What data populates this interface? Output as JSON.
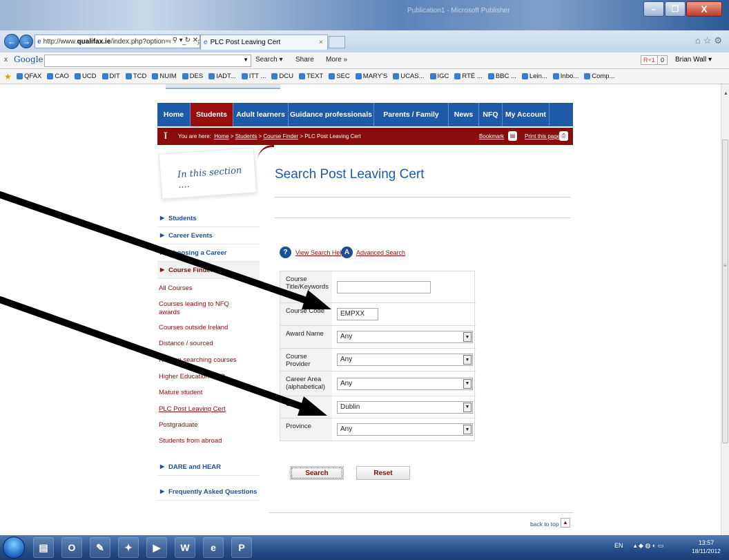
{
  "window": {
    "title": "Publication1 - Microsoft Publisher",
    "min_symbol": "–",
    "max_symbol": "❐",
    "close_symbol": "X"
  },
  "browser": {
    "address_prefix": "http://www.",
    "address_domain": "qualifax.ie",
    "address_rest": "/index.php?option=com_wrapper&view=w",
    "address_controls": "⚲ ▾ ↻ ✕",
    "tab_title": "PLC Post Leaving Cert",
    "tab_close": "×",
    "right_icons": "⌂☆⚙"
  },
  "google_toolbar": {
    "close": "x",
    "logo": "Google",
    "search_label": "Search ▾",
    "share_label": "Share",
    "more_label": "More »",
    "plusone": "R+1",
    "plusone_count": "0",
    "user": "Brian Wall ▾"
  },
  "favorites": [
    "QFAX",
    "CAO",
    "UCD",
    "DIT",
    "TCD",
    "NUIM",
    "DES",
    "IADT...",
    "ITT ...",
    "DCU",
    "TEXT",
    "SEC",
    "MARY'S",
    "UCAS...",
    "IGC",
    "RTÉ ...",
    "BBC ...",
    "Lein...",
    "Inbo...",
    "Comp..."
  ],
  "mainnav": [
    "Home",
    "Students",
    "Adult learners",
    "Guidance professionals",
    "Parents / Family",
    "News",
    "NFQ",
    "My Account"
  ],
  "breadcrumb": {
    "prefix": "You are here:",
    "home": "Home",
    "sep": ">",
    "students": "Students",
    "finder": "Course Finder",
    "current": "PLC Post Leaving Cert",
    "bookmark": "Bookmark",
    "print": "Print this page"
  },
  "sidebar": {
    "section_title": "In this section ....",
    "items_top": [
      "Students",
      "Career Events",
      "Choosing a Career",
      "Course Finder"
    ],
    "sub_items": [
      "All Courses",
      "Courses leading to NFQ awards",
      "Courses outside Ireland",
      "Distance / sourced",
      "Help on searching courses",
      "Higher Education CAO",
      "Mature student",
      "PLC Post Leaving Cert",
      "Postgraduate",
      "Students from abroad"
    ],
    "items_bottom": [
      "DARE and HEAR",
      "Frequently Asked Questions"
    ]
  },
  "main": {
    "heading": "Search Post Leaving Cert",
    "help_icon": "?",
    "help_link": "View Search Help",
    "adv_icon": "A",
    "adv_link": "Advanced Search"
  },
  "form": {
    "rows": [
      {
        "label": "Course Title/Keywords",
        "type": "text",
        "value": ""
      },
      {
        "label": "Course Code",
        "type": "text",
        "value": "EMPXX"
      },
      {
        "label": "Award Name",
        "type": "select",
        "value": "Any"
      },
      {
        "label": "Course Provider",
        "type": "select",
        "value": "Any"
      },
      {
        "label": "Career Area (alphabetical)",
        "type": "select",
        "value": "Any"
      },
      {
        "label": "County",
        "type": "select",
        "value": "Dublin"
      },
      {
        "label": "Province",
        "type": "select",
        "value": "Any"
      }
    ],
    "search_button": "Search",
    "reset_button": "Reset",
    "back_to_top": "back to top"
  },
  "taskbar": {
    "apps": [
      "folder",
      "outlook",
      "paint",
      "network",
      "cursor",
      "word",
      "ie",
      "publisher"
    ],
    "lang": "EN",
    "time": "13:57",
    "date": "18/11/2012"
  },
  "colors": {
    "nav_blue": "#1f5aa8",
    "crimson": "#8b0c0c"
  }
}
